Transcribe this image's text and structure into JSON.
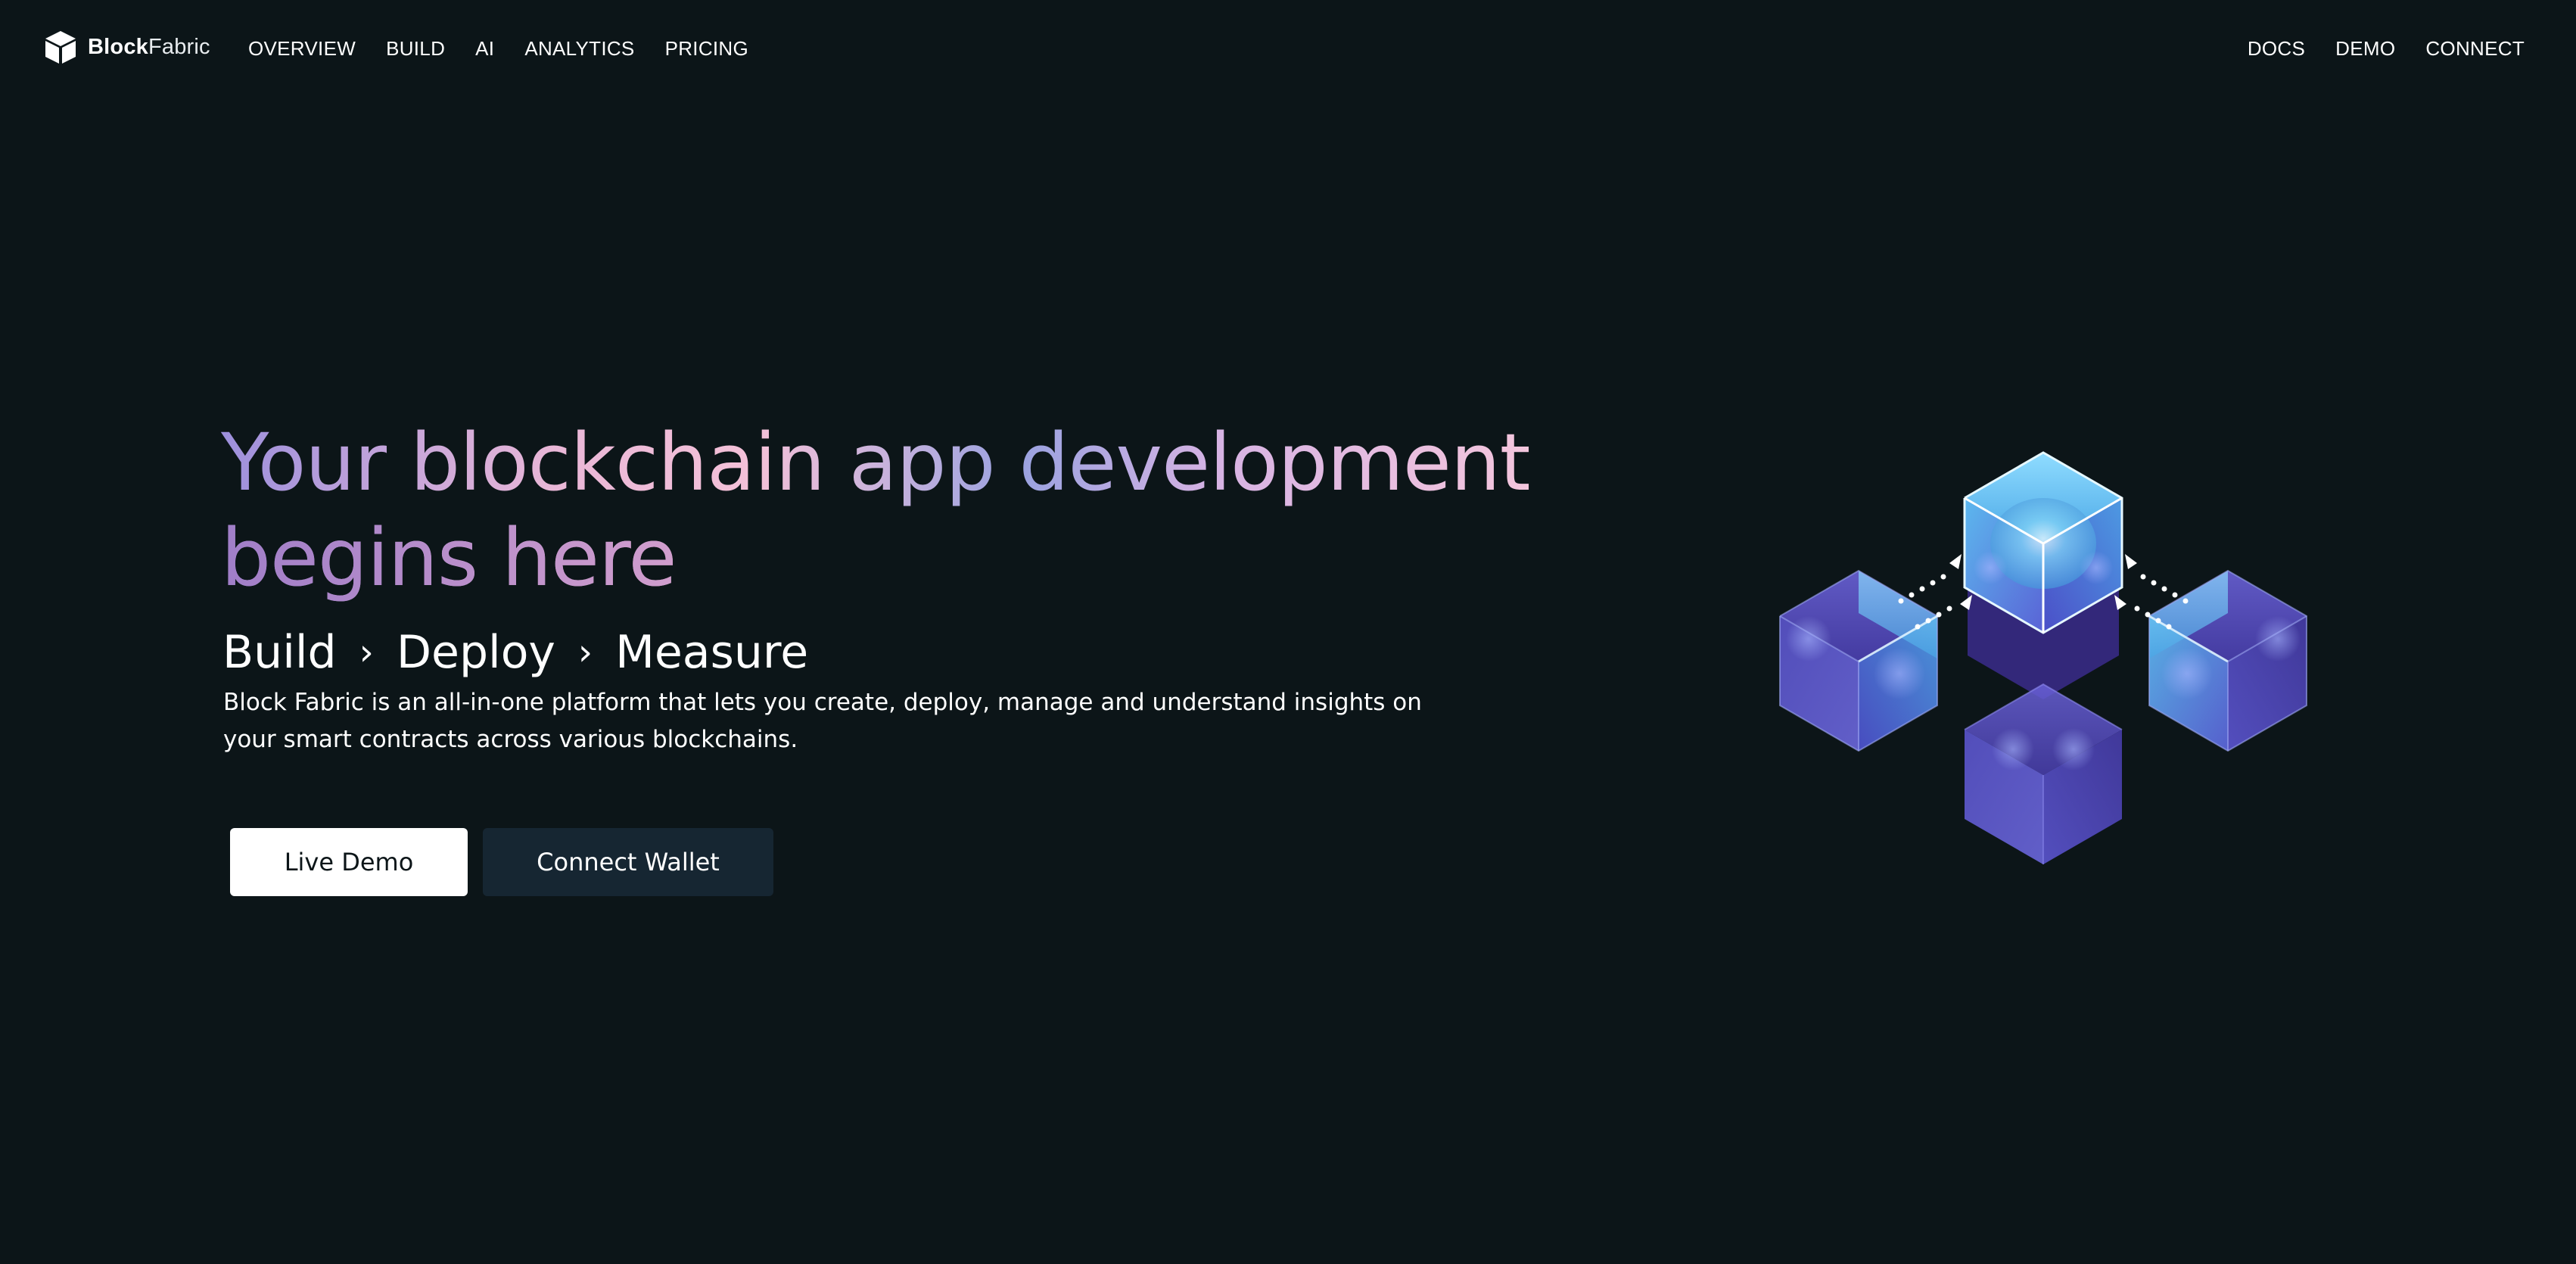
{
  "brand": {
    "name_strong": "Block",
    "name_light": "Fabric",
    "logo_icon": "cube-icon"
  },
  "nav": {
    "left": [
      "OVERVIEW",
      "BUILD",
      "AI",
      "ANALYTICS",
      "PRICING"
    ],
    "right": [
      "DOCS",
      "DEMO",
      "CONNECT"
    ]
  },
  "hero": {
    "title_line1": "Your blockchain app development",
    "title_line2": "begins here",
    "steps": [
      "Build",
      "Deploy",
      "Measure"
    ],
    "step_separator": "›",
    "description": "Block Fabric is an all-in-one platform that lets you create, deploy, manage and understand insights on your smart contracts across various blockchains.",
    "primary_button": "Live Demo",
    "secondary_button": "Connect Wallet"
  },
  "illustration": {
    "icon": "blockchain-cubes-illustration"
  },
  "colors": {
    "background": "#0c1518",
    "secondary_button_bg": "#162632",
    "primary_button_bg": "#ffffff",
    "cube_light": "#7ec8f0",
    "cube_purple": "#3b2f8c"
  }
}
